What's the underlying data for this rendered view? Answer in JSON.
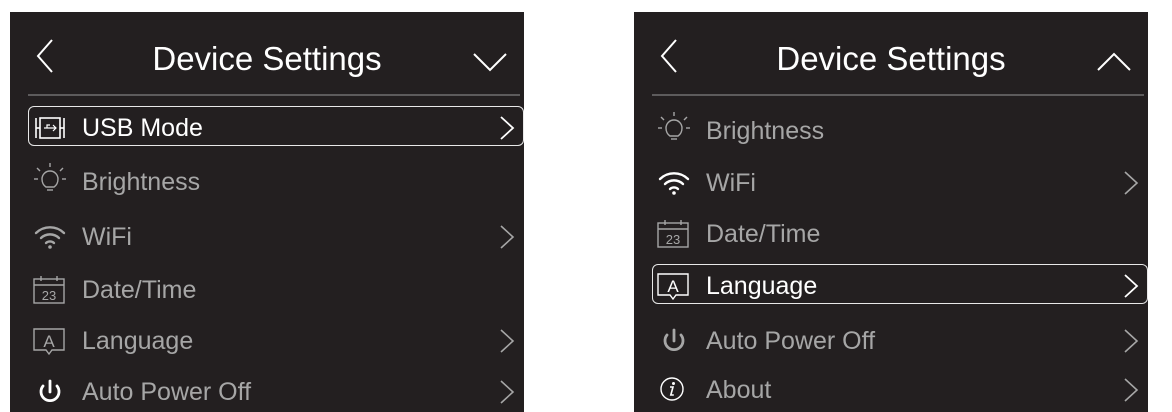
{
  "colors": {
    "background": "#231f20",
    "text_active": "#ffffff",
    "text_inactive": "#a6a6a6",
    "divider": "#5d5b5c"
  },
  "left_screen": {
    "title": "Device Settings",
    "back_icon": "chevron-left-icon",
    "scroll_icon": "chevron-down-icon",
    "items": [
      {
        "label": "USB Mode",
        "icon": "usb-mode-icon",
        "selected": true,
        "has_chevron": true
      },
      {
        "label": "Brightness",
        "icon": "bulb-icon",
        "selected": false,
        "has_chevron": false
      },
      {
        "label": "WiFi",
        "icon": "wifi-icon",
        "selected": false,
        "has_chevron": true
      },
      {
        "label": "Date/Time",
        "icon": "calendar-icon",
        "calendar_day": "23",
        "selected": false,
        "has_chevron": false
      },
      {
        "label": "Language",
        "icon": "language-icon",
        "icon_letter": "A",
        "selected": false,
        "has_chevron": true
      },
      {
        "label": "Auto Power Off",
        "icon": "power-icon",
        "selected": false,
        "has_chevron": true
      }
    ]
  },
  "right_screen": {
    "title": "Device Settings",
    "back_icon": "chevron-left-icon",
    "scroll_icon": "chevron-up-icon",
    "items": [
      {
        "label": "Brightness",
        "icon": "bulb-icon",
        "selected": false,
        "has_chevron": false
      },
      {
        "label": "WiFi",
        "icon": "wifi-icon",
        "selected": false,
        "has_chevron": true
      },
      {
        "label": "Date/Time",
        "icon": "calendar-icon",
        "calendar_day": "23",
        "selected": false,
        "has_chevron": false
      },
      {
        "label": "Language",
        "icon": "language-icon",
        "icon_letter": "A",
        "selected": true,
        "has_chevron": true
      },
      {
        "label": "Auto Power Off",
        "icon": "power-icon",
        "selected": false,
        "has_chevron": true
      },
      {
        "label": "About",
        "icon": "info-icon",
        "selected": false,
        "has_chevron": true
      }
    ]
  }
}
